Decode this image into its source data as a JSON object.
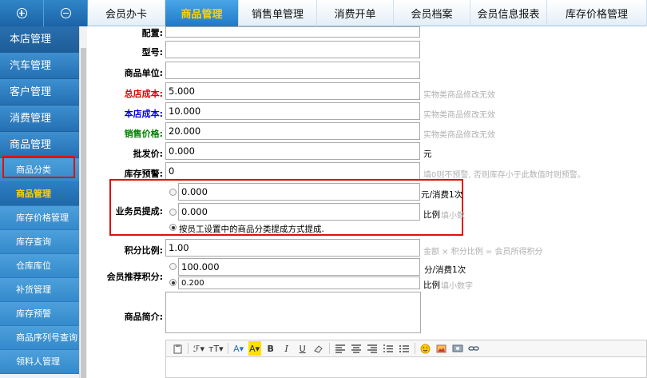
{
  "top_tabs": [
    {
      "label": "会员办卡",
      "active": false
    },
    {
      "label": "商品管理",
      "active": true
    },
    {
      "label": "销售单管理",
      "active": false
    },
    {
      "label": "消费开单",
      "active": false
    },
    {
      "label": "会员档案",
      "active": false
    },
    {
      "label": "会员信息报表",
      "active": false
    },
    {
      "label": "库存价格管理",
      "active": false
    }
  ],
  "sidebar": {
    "main": [
      "本店管理",
      "汽车管理",
      "客户管理",
      "消费管理",
      "商品管理"
    ],
    "sub": [
      "商品分类",
      "商品管理",
      "库存价格管理",
      "库存查询",
      "仓库库位",
      "补货管理",
      "库存预警",
      "商品序列号查询",
      "领料人管理"
    ],
    "active_sub": "商品管理"
  },
  "form": {
    "config_label": "配置:",
    "model_label": "型号:",
    "unit_label": "商品单位:",
    "hq_cost_label": "总店成本:",
    "hq_cost_value": "5.000",
    "store_cost_label": "本店成本:",
    "store_cost_value": "10.000",
    "sale_price_label": "销售价格:",
    "sale_price_value": "20.000",
    "physical_hint": "实物类商品修改无效",
    "wholesale_label": "批发价:",
    "wholesale_value": "0.000",
    "wholesale_unit": "元",
    "stock_alert_label": "库存预警:",
    "stock_alert_value": "0",
    "stock_alert_hint": "填0则不预警, 否则库存小于此数值时则预警。",
    "commission_label": "业务员提成:",
    "commission_amount": "0.000",
    "commission_amount_unit": "元/消费1次",
    "commission_ratio": "0.000",
    "commission_ratio_unit": "比例",
    "commission_ratio_hint": "填小数",
    "commission_by_category": "按员工设置中的商品分类提成方式提成.",
    "points_ratio_label": "积分比例:",
    "points_ratio_value": "1.00",
    "points_ratio_hint": "金额 × 积分比例 = 会员所得积分",
    "referral_label": "会员推荐积分:",
    "referral_amount": "100.000",
    "referral_amount_unit": "分/消费1次",
    "referral_ratio": "0.200",
    "referral_ratio_unit": "比例",
    "referral_ratio_hint": "填小数字",
    "intro_label": "商品简介:"
  },
  "editor_toolbar": {
    "font_family": "ℱ▾",
    "font_size": "тT▾",
    "font_color": "A▾",
    "bg_color": "A▾",
    "bold": "B",
    "italic": "I",
    "underline": "U"
  },
  "colors": {
    "hq_cost": "#e00000",
    "store_cost": "#0000e0",
    "sale_price": "#008000",
    "active_tab_text": "#ffd200",
    "highlight_box": "#e01010"
  }
}
